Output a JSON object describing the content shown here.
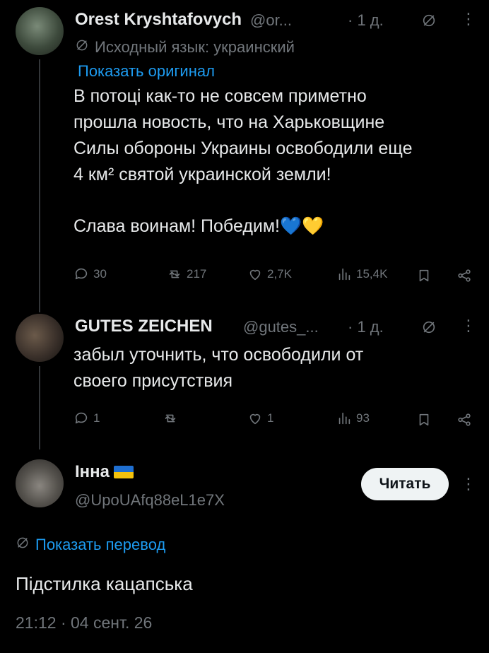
{
  "tweet1": {
    "display_name": "Orest Kryshtafovych",
    "handle": "@or...",
    "time": "· 1 д.",
    "source_lang": "Исходный язык: украинский",
    "show_original": "Показать оригинал",
    "text_lines": [
      "В потоці как-то не совсем приметно",
      "прошла новость, что на Харьковщине",
      "Силы обороны Украины освободили еще",
      "4 км² святой украинской земли!"
    ],
    "text_line5": "Слава воинам! Победим!💙💛",
    "stats": {
      "replies": "30",
      "retweets": "217",
      "likes": "2,7K",
      "views": "15,4K"
    }
  },
  "tweet2": {
    "display_name": "GUTES ZEICHEN",
    "handle": "@gutes_...",
    "time": "· 1 д.",
    "text_lines": [
      "забыл уточнить, что освободили от",
      "своего присутствия"
    ],
    "stats": {
      "replies": "1",
      "retweets": "",
      "likes": "1",
      "views": "93"
    }
  },
  "tweet3": {
    "display_name": "Інна",
    "handle": "@UpoUAfq88eL1e7X",
    "follow_label": "Читать",
    "show_translation": "Показать перевод",
    "text": "Підстилка кацапська",
    "timestamp": "21:12 · 04 сент. 26"
  },
  "colors": {
    "accent": "#1d9bf0",
    "muted": "#71767b",
    "background": "#000000",
    "text": "#e7e9ea"
  }
}
